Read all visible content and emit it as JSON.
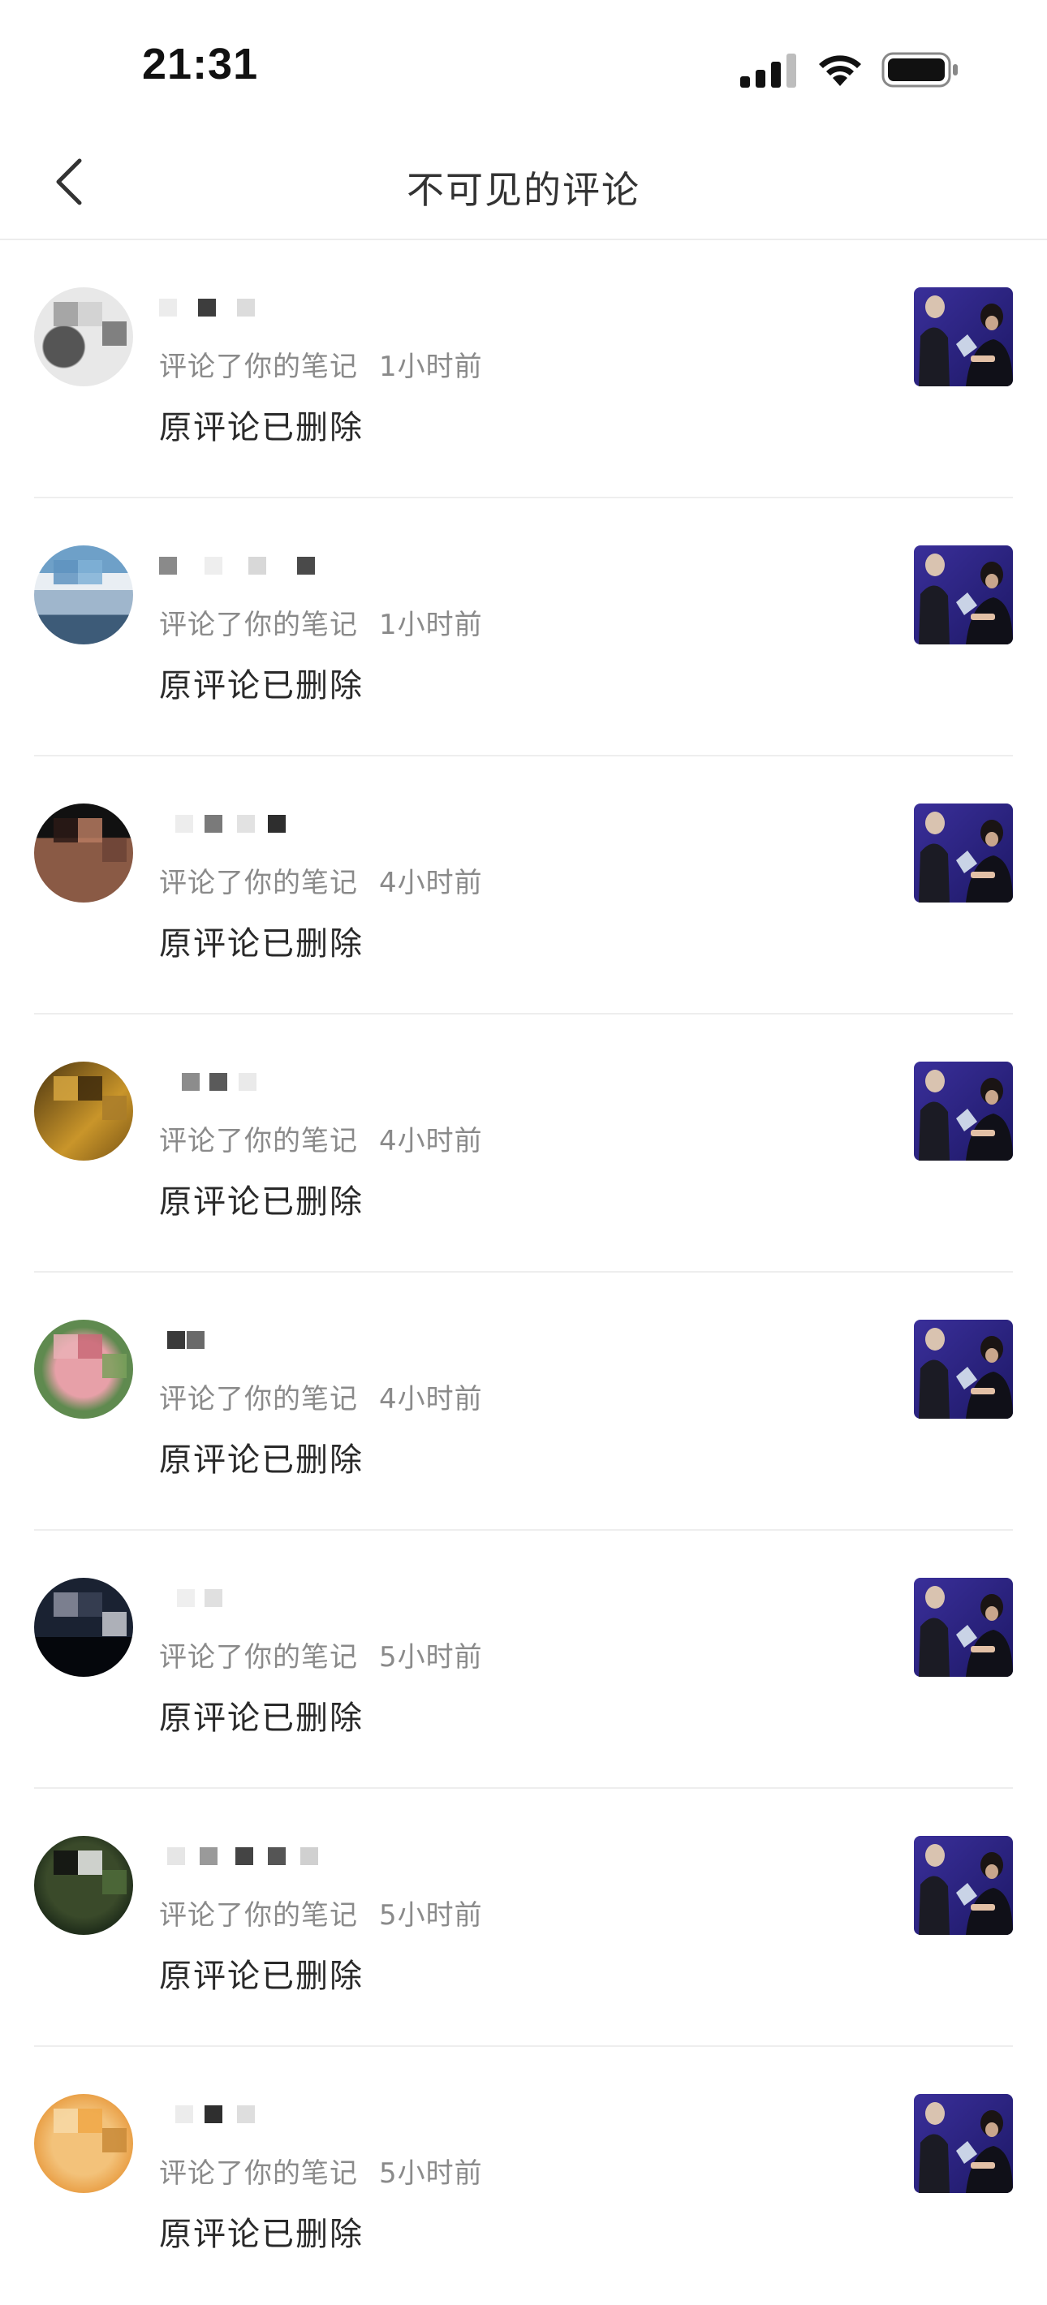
{
  "status_bar": {
    "time": "21:31",
    "icons": [
      "cellular-signal-icon",
      "wifi-icon",
      "battery-icon"
    ]
  },
  "nav": {
    "back_icon": "chevron-left-icon",
    "title": "不可见的评论"
  },
  "colors": {
    "text_primary": "#2a2a2a",
    "text_secondary": "#8a8a8a",
    "divider": "#eeeeee",
    "thumbnail_bg": "#3a2f9a"
  },
  "items": [
    {
      "action": "评论了你的笔记",
      "time": "1小时前",
      "content": "原评论已删除",
      "avatar": "blurred-avatar"
    },
    {
      "action": "评论了你的笔记",
      "time": "1小时前",
      "content": "原评论已删除",
      "avatar": "blurred-avatar"
    },
    {
      "action": "评论了你的笔记",
      "time": "4小时前",
      "content": "原评论已删除",
      "avatar": "blurred-avatar"
    },
    {
      "action": "评论了你的笔记",
      "time": "4小时前",
      "content": "原评论已删除",
      "avatar": "blurred-avatar"
    },
    {
      "action": "评论了你的笔记",
      "time": "4小时前",
      "content": "原评论已删除",
      "avatar": "blurred-avatar"
    },
    {
      "action": "评论了你的笔记",
      "time": "5小时前",
      "content": "原评论已删除",
      "avatar": "blurred-avatar"
    },
    {
      "action": "评论了你的笔记",
      "time": "5小时前",
      "content": "原评论已删除",
      "avatar": "blurred-avatar"
    },
    {
      "action": "评论了你的笔记",
      "time": "5小时前",
      "content": "原评论已删除",
      "avatar": "blurred-avatar"
    }
  ]
}
